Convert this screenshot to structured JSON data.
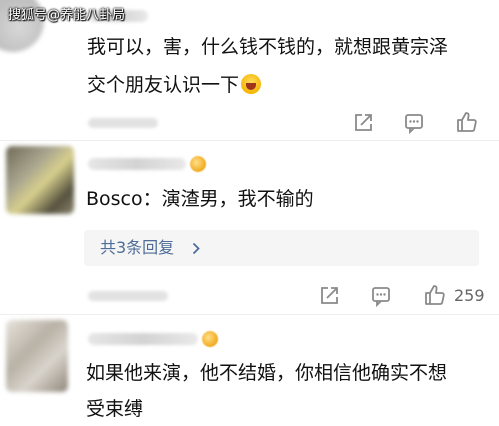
{
  "watermark": "搜狐号@养能八卦局",
  "comments": [
    {
      "text_line1": "我可以，害，什么钱不钱的，就想跟黄宗泽",
      "text_line2": "交个朋友认识一下",
      "emoji": "laughing-emoji"
    },
    {
      "text_line1": "Bosco：演渣男，我不输的",
      "reply_label": "共3条回复",
      "like_count": "259"
    },
    {
      "text_line1": "如果他来演，他不结婚，你相信他确实不想",
      "text_line2": "受束缚"
    }
  ],
  "colors": {
    "link": "#4d6d98",
    "icon": "#8a8a8a",
    "text": "#111111"
  }
}
